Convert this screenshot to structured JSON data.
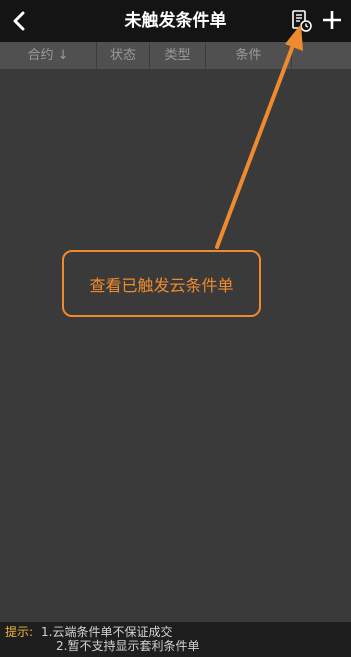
{
  "header": {
    "title": "未触发条件单",
    "back_icon": "chevron-left-icon",
    "history_icon": "document-clock-icon",
    "add_icon": "plus-icon"
  },
  "columns": {
    "contract": "合约 ↓",
    "status": "状态",
    "type": "类型",
    "condition": "条件"
  },
  "callout": {
    "text": "查看已触发云条件单",
    "color": "#f08a2e"
  },
  "tips": {
    "label": "提示:",
    "line1": "1.云端条件单不保证成交",
    "line2": "2.暂不支持显示套利条件单"
  }
}
